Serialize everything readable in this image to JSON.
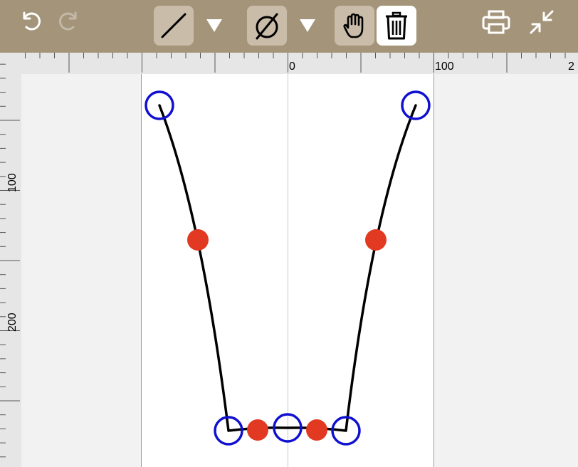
{
  "toolbar": {
    "undo": {
      "icon": "undo-icon"
    },
    "redo": {
      "icon": "redo-icon",
      "enabled": false
    },
    "line_tool": {
      "icon": "line-tool-icon"
    },
    "diameter_tool": {
      "icon": "diameter-icon"
    },
    "hand_tool": {
      "icon": "hand-icon"
    },
    "delete": {
      "icon": "trash-icon"
    },
    "print": {
      "icon": "printer-icon"
    },
    "collapse": {
      "icon": "collapse-icon"
    }
  },
  "rulers": {
    "top_labels": [
      "0",
      "100",
      "2"
    ],
    "left_labels": [
      "100",
      "200"
    ]
  },
  "colors": {
    "toolbar": "#a49479",
    "handle_endpoint": "#1010d0",
    "handle_midpoint": "#e23a22",
    "curve": "#000000"
  }
}
